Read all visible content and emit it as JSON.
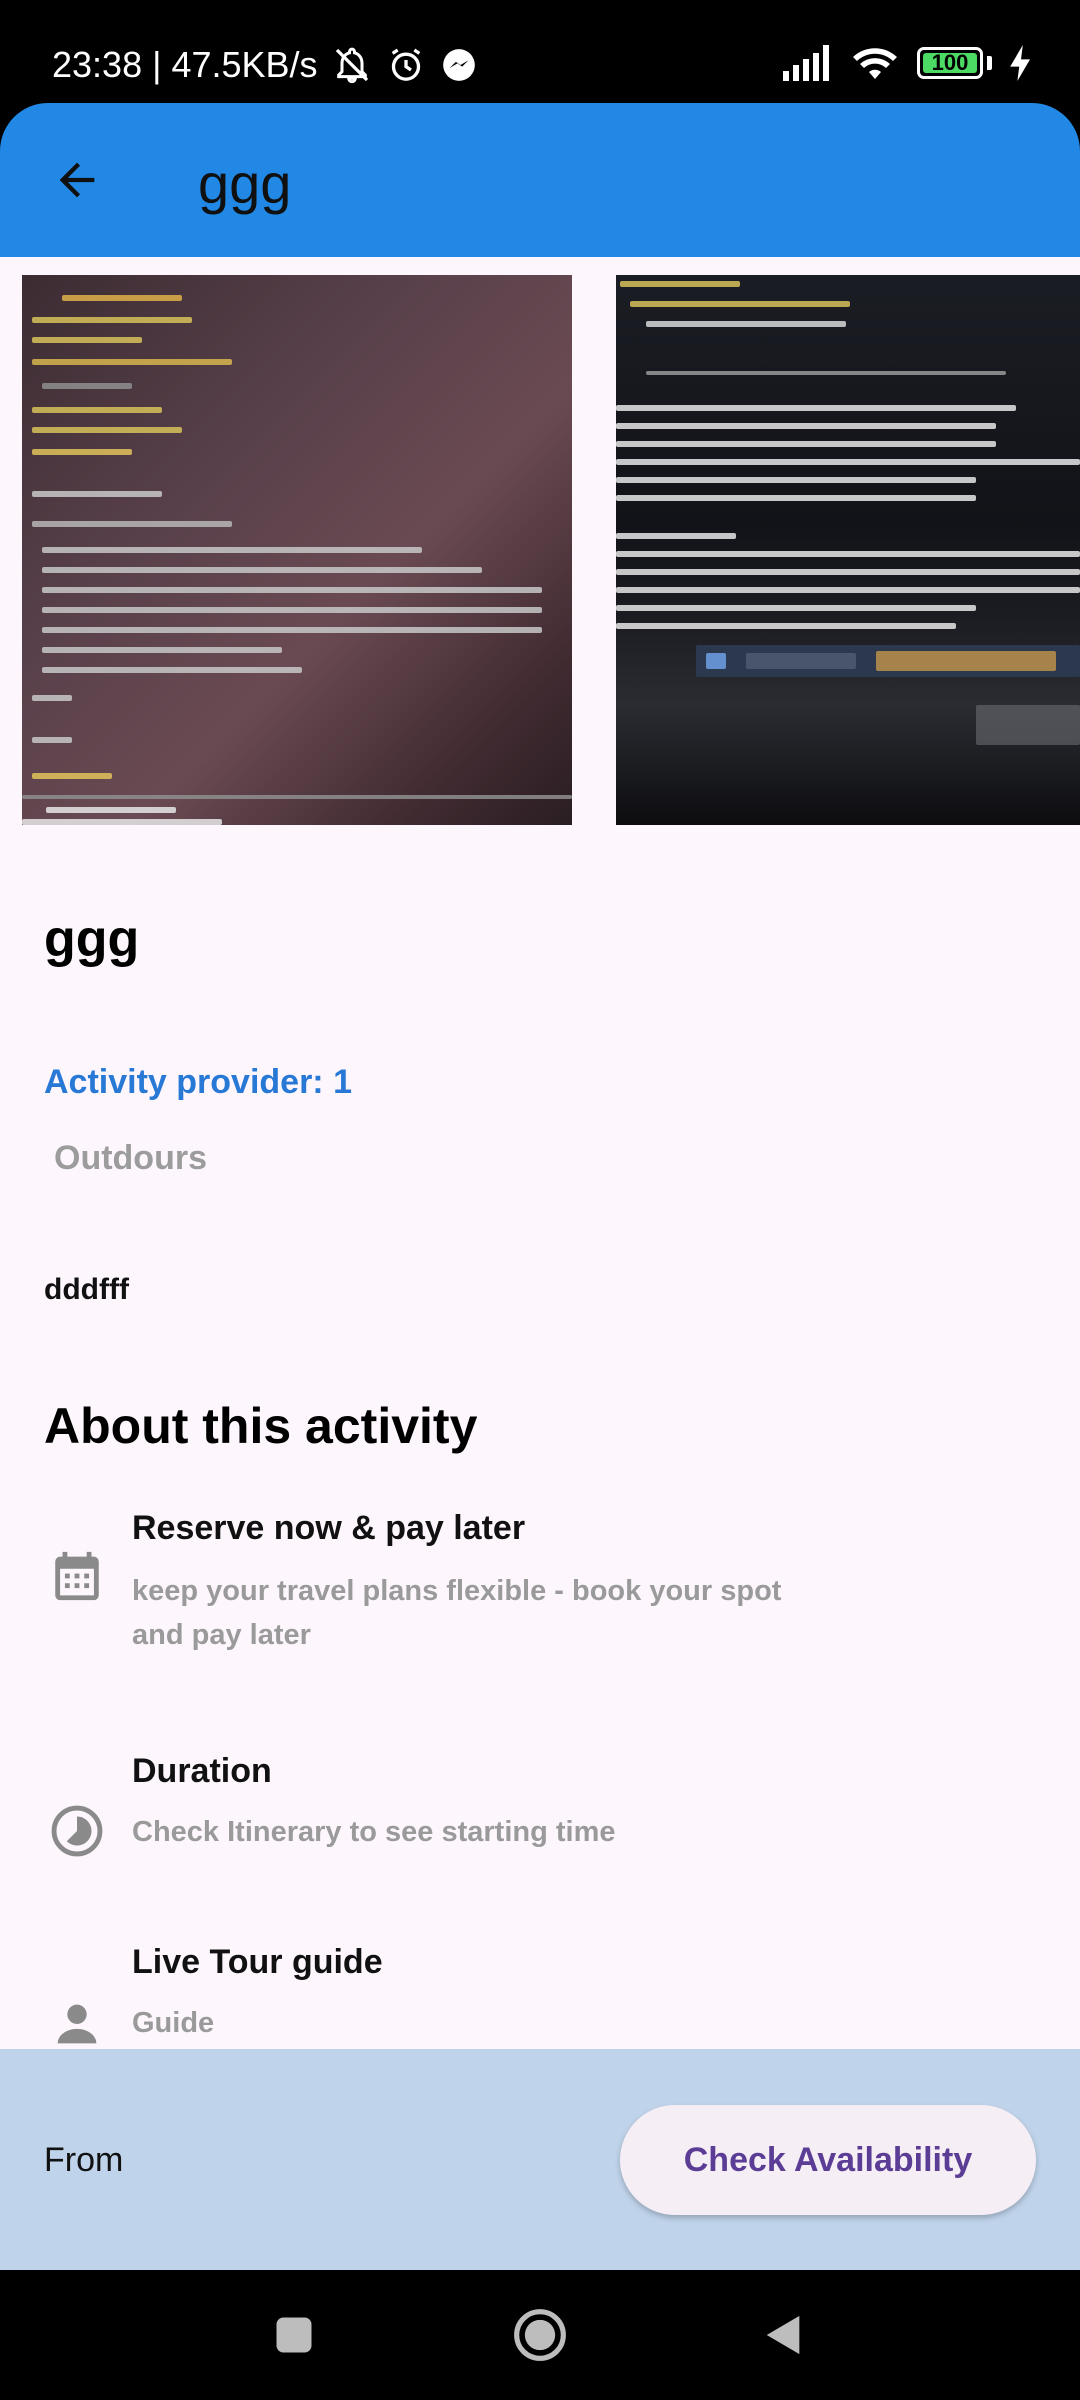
{
  "status_bar": {
    "time_speed": "23:38 | 47.5KB/s",
    "battery": "100"
  },
  "app_bar": {
    "title": "ggg",
    "back_icon": "arrow-back-icon"
  },
  "activity": {
    "title": "ggg",
    "provider": "Activity provider: 1",
    "category": "Outdours",
    "description": "dddfff",
    "photos": [
      "code-screenshot-photo",
      "terminal-screenshot-photo"
    ]
  },
  "about": {
    "heading": "About this activity",
    "features": [
      {
        "icon": "calendar-icon",
        "title": "Reserve now & pay later",
        "subtitle_line1": "keep your travel plans flexible - book your spot",
        "subtitle_line2": " and pay later"
      },
      {
        "icon": "clock-icon",
        "title": "Duration",
        "subtitle_line1": "Check Itinerary to see starting time"
      },
      {
        "icon": "person-icon",
        "title": "Live Tour guide",
        "subtitle_line1": "Guide"
      }
    ]
  },
  "bottom_bar": {
    "from_label": "From",
    "check_button": "Check Availability"
  },
  "colors": {
    "app_bar": "#2188e5",
    "provider_text": "#2878d6",
    "bottom_bar": "#bfd3ea",
    "button_text": "#5b3d96"
  }
}
